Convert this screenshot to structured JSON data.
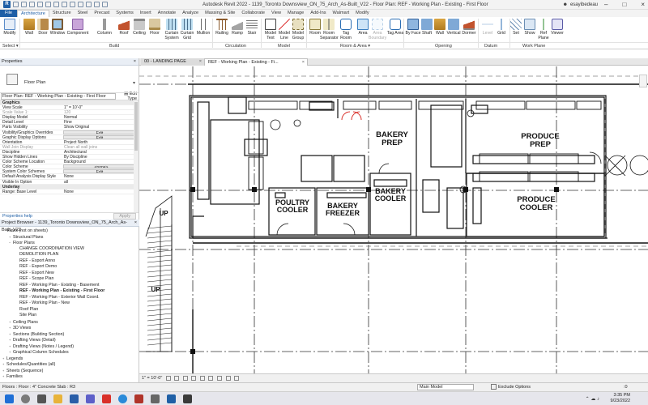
{
  "window": {
    "title": "Autodesk Revit 2022 - 1139_Toronto Downsview_ON_75_Arch_As-Built_V22 - Floor Plan: REF - Working Plan - Existing - First Floor",
    "user": "esayibedeau",
    "qat_logo": "R"
  },
  "ribbon_tabs": [
    "File",
    "Architecture",
    "Structure",
    "Steel",
    "Precast",
    "Systems",
    "Insert",
    "Annotate",
    "Analyze",
    "Massing & Site",
    "Collaborate",
    "View",
    "Manage",
    "Add-Ins",
    "Walmart",
    "Modify"
  ],
  "ribbon": {
    "modify": "Modify",
    "select": "Select ▾",
    "buttons": {
      "wall": "Wall",
      "door": "Door",
      "window": "Window",
      "component": "Component",
      "column": "Column",
      "roof": "Roof",
      "ceiling": "Ceiling",
      "floor": "Floor",
      "curtain_system": "Curtain System",
      "curtain_grid": "Curtain Grid",
      "mullion": "Mullion",
      "railing": "Railing",
      "ramp": "Ramp",
      "stair": "Stair",
      "model_text": "Model Text",
      "model_line": "Model Line",
      "model_group": "Model Group",
      "room": "Room",
      "room_separator": "Room Separator",
      "tag_room": "Tag Room",
      "area": "Area",
      "area_boundary": "Area Boundary",
      "tag_area": "Tag Area",
      "by_face": "By Face",
      "shaft": "Shaft",
      "wall_open": "Wall",
      "vertical": "Vertical",
      "dormer": "Dormer",
      "level": "Level",
      "grid": "Grid",
      "set": "Set",
      "show": "Show",
      "ref_plane": "Ref Plane",
      "viewer": "Viewer"
    },
    "panels": {
      "build": "Build",
      "circulation": "Circulation",
      "model": "Model",
      "room_area": "Room & Area ▾",
      "opening": "Opening",
      "datum": "Datum",
      "work_plane": "Work Plane"
    }
  },
  "properties": {
    "header": "Properties",
    "close": "×",
    "type_name": "Floor Plan",
    "instance_selector": "Floor Plan: REF - Working Plan - Existing - First Floor",
    "edit_type": "Edit Type",
    "rows": [
      {
        "name": "Graphics",
        "value": "",
        "kind": "cat"
      },
      {
        "name": "View Scale",
        "value": "1\" = 10'-0\"",
        "kind": ""
      },
      {
        "name": "Scale Value    1:",
        "value": "120",
        "kind": "dis"
      },
      {
        "name": "Display Model",
        "value": "Normal",
        "kind": ""
      },
      {
        "name": "Detail Level",
        "value": "Fine",
        "kind": ""
      },
      {
        "name": "Parts Visibility",
        "value": "Show Original",
        "kind": ""
      },
      {
        "name": "Visibility/Graphics Overrides",
        "value": "Edit...",
        "kind": "btn"
      },
      {
        "name": "Graphic Display Options",
        "value": "Edit...",
        "kind": "btn"
      },
      {
        "name": "Orientation",
        "value": "Project North",
        "kind": ""
      },
      {
        "name": "Wall Join Display",
        "value": "Clean all wall joins",
        "kind": "dis"
      },
      {
        "name": "Discipline",
        "value": "Architectural",
        "kind": ""
      },
      {
        "name": "Show Hidden Lines",
        "value": "By Discipline",
        "kind": ""
      },
      {
        "name": "Color Scheme Location",
        "value": "Background",
        "kind": ""
      },
      {
        "name": "Color Scheme",
        "value": "<none>",
        "kind": "btn"
      },
      {
        "name": "System Color Schemes",
        "value": "Edit...",
        "kind": "btn"
      },
      {
        "name": "Default Analysis Display Style",
        "value": "None",
        "kind": ""
      },
      {
        "name": "Visible In Option",
        "value": "all",
        "kind": ""
      },
      {
        "name": "Underlay",
        "value": "",
        "kind": "cat"
      },
      {
        "name": "Range: Base Level",
        "value": "None",
        "kind": ""
      }
    ],
    "help": "Properties help",
    "apply": "Apply"
  },
  "project_browser": {
    "header": "Project Browser - 1139_Toronto Downsview_ON_75_Arch_As-Built_V22",
    "close": "×",
    "items": [
      {
        "label": "Views (not on sheets)",
        "depth": 0,
        "toggle": "−",
        "bold": false
      },
      {
        "label": "Structural Plans",
        "depth": 1,
        "toggle": "+",
        "bold": false
      },
      {
        "label": "Floor Plans",
        "depth": 1,
        "toggle": "−",
        "bold": false
      },
      {
        "label": "CHANGE COORDINATION VIEW",
        "depth": 2,
        "toggle": "",
        "bold": false
      },
      {
        "label": "DEMOLITION PLAN",
        "depth": 2,
        "toggle": "",
        "bold": false
      },
      {
        "label": "REF - Export Anno",
        "depth": 2,
        "toggle": "",
        "bold": false
      },
      {
        "label": "REF - Export Demo",
        "depth": 2,
        "toggle": "",
        "bold": false
      },
      {
        "label": "REF - Export New",
        "depth": 2,
        "toggle": "",
        "bold": false
      },
      {
        "label": "REF - Scope Plan",
        "depth": 2,
        "toggle": "",
        "bold": false
      },
      {
        "label": "REF - Working Plan - Existing - Basement",
        "depth": 2,
        "toggle": "",
        "bold": false
      },
      {
        "label": "REF - Working Plan - Existing - First Floor",
        "depth": 2,
        "toggle": "",
        "bold": true
      },
      {
        "label": "REF - Working Plan - Exterior Wall Coord.",
        "depth": 2,
        "toggle": "",
        "bold": false
      },
      {
        "label": "REF - Working Plan - New",
        "depth": 2,
        "toggle": "",
        "bold": false
      },
      {
        "label": "Roof Plan",
        "depth": 2,
        "toggle": "",
        "bold": false
      },
      {
        "label": "Site Plan",
        "depth": 2,
        "toggle": "",
        "bold": false
      },
      {
        "label": "Ceiling Plans",
        "depth": 1,
        "toggle": "+",
        "bold": false
      },
      {
        "label": "3D Views",
        "depth": 1,
        "toggle": "+",
        "bold": false
      },
      {
        "label": "Sections (Building Section)",
        "depth": 1,
        "toggle": "+",
        "bold": false
      },
      {
        "label": "Drafting Views (Detail)",
        "depth": 1,
        "toggle": "+",
        "bold": false
      },
      {
        "label": "Drafting Views (Notes / Legend)",
        "depth": 1,
        "toggle": "+",
        "bold": false
      },
      {
        "label": "Graphical Column Schedules",
        "depth": 1,
        "toggle": "+",
        "bold": false
      },
      {
        "label": "Legends",
        "depth": 0,
        "toggle": "+",
        "bold": false
      },
      {
        "label": "Schedules/Quantities (all)",
        "depth": 0,
        "toggle": "+",
        "bold": false
      },
      {
        "label": "Sheets (Sequence)",
        "depth": 0,
        "toggle": "+",
        "bold": false
      },
      {
        "label": "Families",
        "depth": 0,
        "toggle": "+",
        "bold": false
      }
    ]
  },
  "view_tabs": {
    "tab1": "00 - LANDING PAGE",
    "tab2": "REF - Working Plan - Existing - Fi...",
    "close": "×"
  },
  "drawing": {
    "rooms": [
      {
        "id": "bakery-prep",
        "label": "BAKERY\nPREP"
      },
      {
        "id": "produce-prep",
        "label": "PRODUCE\nPREP"
      },
      {
        "id": "bakery-cooler",
        "label": "BAKERY\nCOOLER"
      },
      {
        "id": "produce-cooler",
        "label": "PRODUCE\nCOOLER"
      },
      {
        "id": "poultry-cooler",
        "label": "POULTRY\nCOOLER"
      },
      {
        "id": "bakery-freezer",
        "label": "BAKERY\nFREEZER"
      }
    ],
    "stair_labels": [
      "UP",
      "UP"
    ]
  },
  "view_control": {
    "scale": "1\" = 10'-0\""
  },
  "status_bar": {
    "text": "Floors : Floor : 4\" Concrete Slab : R3",
    "model": "Main Model",
    "exclude": "Exclude Options",
    "filter": ":0"
  },
  "taskbar": {
    "time": "3:35 PM",
    "date": "9/23/2022"
  },
  "colors": {
    "revit_blue": "#1f5fa6",
    "door_swing_red": "#d9302a"
  }
}
